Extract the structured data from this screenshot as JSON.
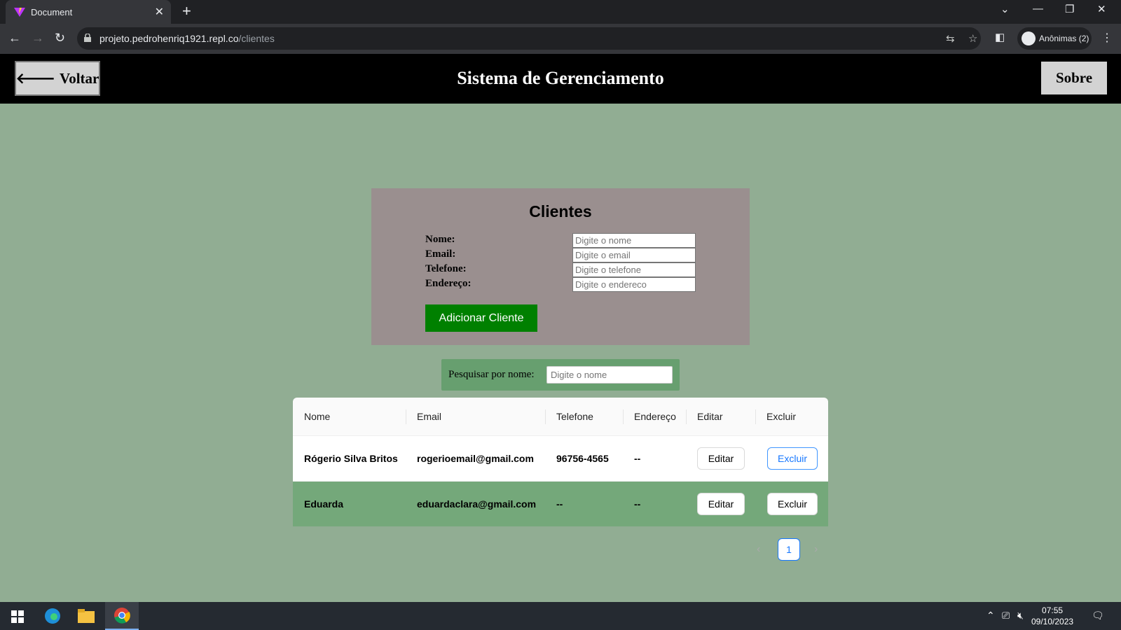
{
  "browser": {
    "tab_title": "Document",
    "url_host": "projeto.pedrohenriq1921.repl.co",
    "url_path": "/clientes",
    "profile_label": "Anônimas (2)"
  },
  "header": {
    "back_label": "Voltar",
    "title": "Sistema de Gerenciamento",
    "about_label": "Sobre"
  },
  "form": {
    "title": "Clientes",
    "fields": [
      {
        "label": "Nome:",
        "placeholder": "Digite o nome"
      },
      {
        "label": "Email:",
        "placeholder": "Digite o email"
      },
      {
        "label": "Telefone:",
        "placeholder": "Digite o telefone"
      },
      {
        "label": "Endereço:",
        "placeholder": "Digite o endereco"
      }
    ],
    "submit_label": "Adicionar Cliente"
  },
  "search": {
    "label": "Pesquisar por nome:",
    "placeholder": "Digite o nome"
  },
  "table": {
    "columns": [
      "Nome",
      "Email",
      "Telefone",
      "Endereço",
      "Editar",
      "Excluir"
    ],
    "rows": [
      {
        "nome": "Rógerio Silva Britos",
        "email": "rogerioemail@gmail.com",
        "telefone": "96756-4565",
        "endereco": "--",
        "edit_label": "Editar",
        "delete_label": "Excluir"
      },
      {
        "nome": "Eduarda",
        "email": "eduardaclara@gmail.com",
        "telefone": "--",
        "endereco": "--",
        "edit_label": "Editar",
        "delete_label": "Excluir"
      }
    ]
  },
  "pagination": {
    "current_page": "1"
  },
  "taskbar": {
    "time": "07:55",
    "date": "09/10/2023"
  },
  "colors": {
    "page_bg": "#91ad93",
    "header_bg": "#000000",
    "form_bg": "#9a8f8f",
    "add_button": "#008000",
    "search_bg": "#679f6f",
    "row_highlight": "#74a87a",
    "accent": "#1677ff"
  }
}
